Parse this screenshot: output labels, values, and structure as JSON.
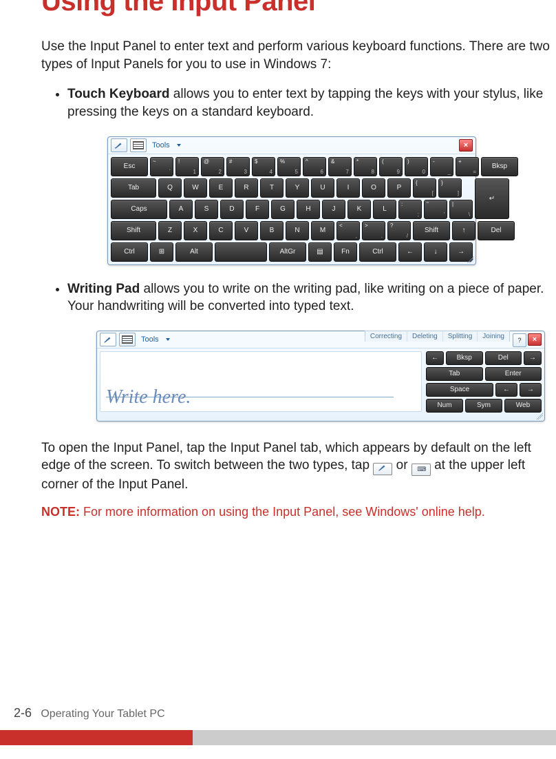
{
  "title": "Using the Input Panel",
  "intro": "Use the Input Panel to enter text and perform various keyboard functions. There are two types of Input Panels for you to use in Windows 7:",
  "bullets": {
    "touch_bold": "Touch Keyboard",
    "touch_rest": " allows you to enter text by tapping the keys with your stylus, like pressing the keys on a standard keyboard.",
    "writing_bold": "Writing Pad",
    "writing_rest": " allows you to write on the writing pad, like writing on a piece of paper. Your handwriting will be converted into typed text."
  },
  "para2a": "To open the Input Panel, tap the Input Panel tab, which appears by default on the left edge of the screen. To switch between the two types, tap ",
  "para2b": " or  ",
  "para2c": " at the upper left corner of the Input Panel.",
  "note_label": "NOTE:",
  "note_text": " For more information on using the Input Panel, see Windows' online help.",
  "footer_page": "2-6",
  "footer_label": "Operating Your Tablet PC",
  "panel": {
    "tools": "Tools",
    "close": "×"
  },
  "kbd": {
    "row1": [
      "Esc",
      "~ `",
      "! 1",
      "@ 2",
      "# 3",
      "$ 4",
      "% 5",
      "^ 6",
      "& 7",
      "* 8",
      "( 9",
      ") 0",
      "- _",
      "+ =",
      "Bksp"
    ],
    "row2": [
      "Tab",
      "Q",
      "W",
      "E",
      "R",
      "T",
      "Y",
      "U",
      "I",
      "O",
      "P",
      "{ [",
      "} ]"
    ],
    "row3": [
      "Caps",
      "A",
      "S",
      "D",
      "F",
      "G",
      "H",
      "J",
      "K",
      "L",
      ": ;",
      "\" '",
      "| \\"
    ],
    "row4": [
      "Shift",
      "Z",
      "X",
      "C",
      "V",
      "B",
      "N",
      "M",
      "< ,",
      "> .",
      "? /",
      "Shift",
      "↑",
      "Del"
    ],
    "row5": [
      "Ctrl",
      "⊞",
      "Alt",
      "",
      "AltGr",
      "▤",
      "Fn",
      "Ctrl",
      "←",
      "↓",
      "→"
    ]
  },
  "wpad": {
    "placeholder": "Write here.",
    "tabs": [
      "Correcting",
      "Deleting",
      "Splitting",
      "Joining"
    ],
    "side": {
      "r1": [
        "←",
        "Bksp",
        "Del",
        "→"
      ],
      "r2": [
        "Tab",
        "Enter"
      ],
      "r3": [
        "Space",
        "←",
        "→"
      ],
      "r4": [
        "Num",
        "Sym",
        "Web"
      ]
    }
  }
}
